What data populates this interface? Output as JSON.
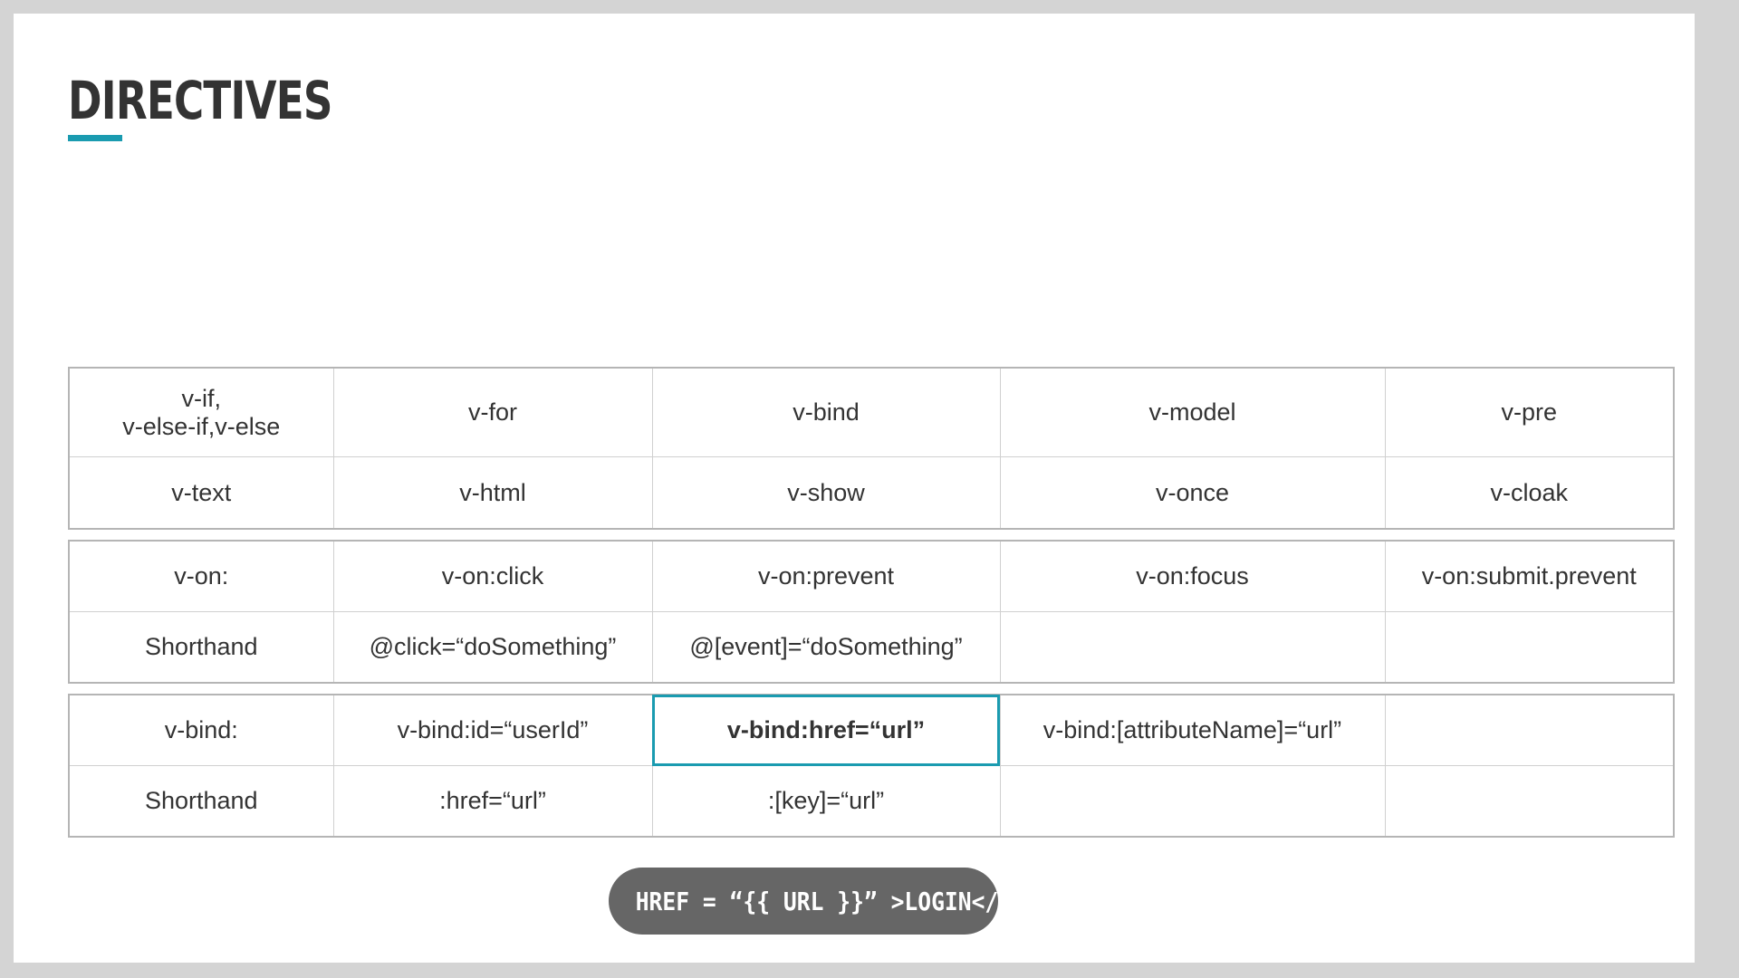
{
  "slide": {
    "title": "DIRECTIVES",
    "accent_color": "#1a9bb0",
    "code_pill": "<A  HREF = “{{ URL }}” >LOGIN</A/"
  },
  "table1": {
    "rows": [
      [
        "v-if,",
        "v-else-if,v-else",
        "v-for",
        "v-bind",
        "v-model",
        "v-pre"
      ],
      [
        "v-text",
        "v-html",
        "v-show",
        "v-once",
        "v-cloak"
      ]
    ]
  },
  "table2": {
    "rows": [
      [
        "v-on:",
        "v-on:click",
        "v-on:prevent",
        "v-on:focus",
        "v-on:submit.prevent"
      ],
      [
        "Shorthand",
        "@click=“doSomething”",
        "@[event]=“doSomething”",
        "",
        ""
      ]
    ]
  },
  "table3": {
    "rows": [
      [
        "v-bind:",
        "v-bind:id=“userId”",
        "v-bind:href=“url”",
        "v-bind:[attributeName]=“url”",
        ""
      ],
      [
        "Shorthand",
        ":href=“url”",
        ":[key]=“url”",
        "",
        ""
      ]
    ],
    "highlighted_cell": "v-bind:href=“url”"
  }
}
